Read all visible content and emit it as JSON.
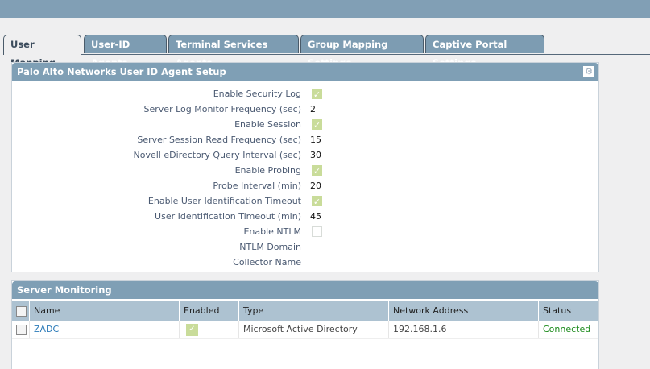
{
  "tabs": [
    "User Mapping",
    "User-ID Agents",
    "Terminal Services Agents",
    "Group Mapping Settings",
    "Captive Portal Settings"
  ],
  "setup": {
    "title": "Palo Alto Networks User ID Agent Setup",
    "fields": [
      {
        "label": "Enable Security Log",
        "checked": true
      },
      {
        "label": "Server Log Monitor Frequency (sec)",
        "value": "2"
      },
      {
        "label": "Enable Session",
        "checked": true
      },
      {
        "label": "Server Session Read Frequency (sec)",
        "value": "15"
      },
      {
        "label": "Novell eDirectory Query Interval (sec)",
        "value": "30"
      },
      {
        "label": "Enable Probing",
        "checked": true
      },
      {
        "label": "Probe Interval (min)",
        "value": "20"
      },
      {
        "label": "Enable User Identification Timeout",
        "checked": true
      },
      {
        "label": "User Identification Timeout (min)",
        "value": "45"
      },
      {
        "label": "Enable NTLM",
        "checked": false
      },
      {
        "label": "NTLM Domain",
        "value": ""
      },
      {
        "label": "Collector Name",
        "value": ""
      }
    ]
  },
  "monitoring": {
    "title": "Server Monitoring",
    "columns": [
      "Name",
      "Enabled",
      "Type",
      "Network Address",
      "Status"
    ],
    "rows": [
      {
        "name": "ZADC",
        "enabled": true,
        "type": "Microsoft Active Directory",
        "address": "192.168.1.6",
        "status": "Connected"
      }
    ]
  },
  "colors": {
    "header": "#7f9fb5",
    "link": "#2a7ab8",
    "connected": "#1a8a1a"
  }
}
